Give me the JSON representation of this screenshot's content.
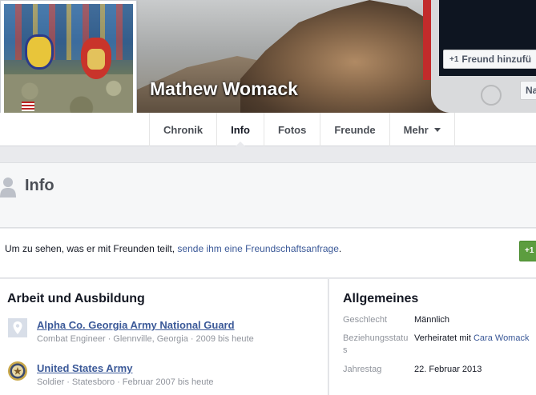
{
  "profile": {
    "name": "Mathew Womack",
    "add_friend_plus": "+1",
    "add_friend_label": "Freund hinzufü",
    "message_label": "Na"
  },
  "nav": {
    "tabs": [
      {
        "label": "Chronik"
      },
      {
        "label": "Info"
      },
      {
        "label": "Fotos"
      },
      {
        "label": "Freunde"
      },
      {
        "label": "Mehr"
      }
    ]
  },
  "info": {
    "title": "Info"
  },
  "notice": {
    "text_before": "Um zu sehen, was er mit Freunden teilt, ",
    "link": "sende ihm eine Freundschaftsanfrage",
    "text_after": ".",
    "button_label": "+1"
  },
  "work": {
    "title": "Arbeit und Ausbildung",
    "items": [
      {
        "icon": "map-pin-icon",
        "name": "Alpha Co. Georgia Army National Guard",
        "role": "Combat Engineer",
        "place": "Glennville, Georgia",
        "period": "2009 bis heute"
      },
      {
        "icon": "army-seal-icon",
        "name": "United States Army",
        "role": "Soldier",
        "place": "Statesboro",
        "period": "Februar 2007 bis heute"
      }
    ]
  },
  "general": {
    "title": "Allgemeines",
    "rows": [
      {
        "label": "Geschlecht",
        "value": "Männlich"
      },
      {
        "label": "Beziehungsstatus",
        "value_prefix": "Verheiratet mit ",
        "value_link": "Cara Womack"
      },
      {
        "label": "Jahrestag",
        "value": "22. Februar 2013"
      }
    ]
  },
  "colors": {
    "link": "#3b5998",
    "muted": "#90949c",
    "add_button": "#5c9d3f",
    "page_bg": "#e9eaed"
  }
}
